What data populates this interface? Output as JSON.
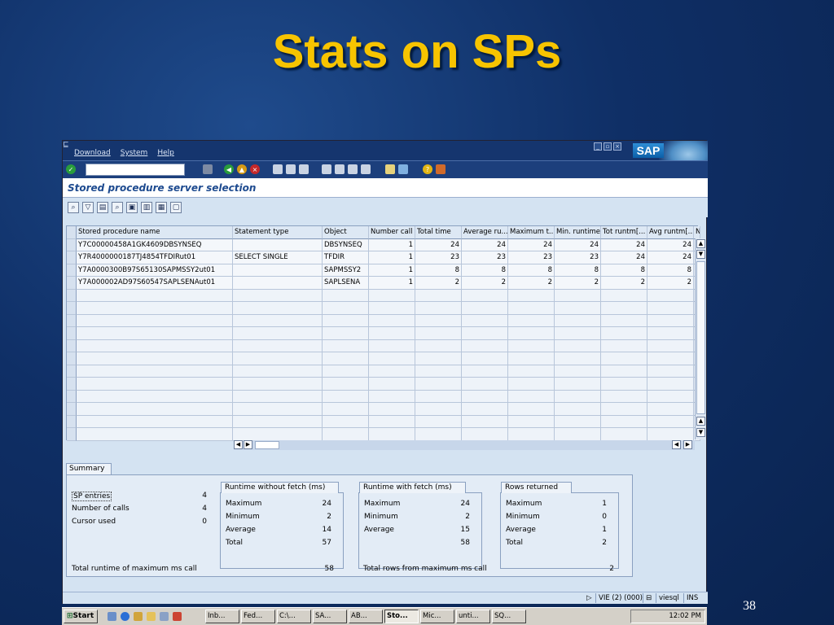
{
  "slide": {
    "title": "Stats on SPs",
    "number": "38"
  },
  "menu": {
    "items": [
      "Download",
      "System",
      "Help"
    ],
    "logo": "SAP"
  },
  "screen_title": "Stored procedure server selection",
  "grid": {
    "columns": [
      "Stored procedure name",
      "Statement type",
      "Object",
      "Number call",
      "Total time",
      "Average ru...",
      "Maximum t...",
      "Min. runtime",
      "Tot runtm[...",
      "Avg runtm[...",
      "N"
    ],
    "rows": [
      [
        "Y7C00000458A1GK4609DBSYNSEQ",
        "",
        "DBSYNSEQ",
        "1",
        "24",
        "24",
        "24",
        "24",
        "24",
        "24"
      ],
      [
        "Y7R4000000187TJ4854TFDIRut01",
        "SELECT SINGLE",
        "TFDIR",
        "1",
        "23",
        "23",
        "23",
        "23",
        "24",
        "24"
      ],
      [
        "Y7A0000300B97S65130SAPMSSY2ut01",
        "",
        "SAPMSSY2",
        "1",
        "8",
        "8",
        "8",
        "8",
        "8",
        "8"
      ],
      [
        "Y7A000002AD97S60547SAPLSENAut01",
        "",
        "SAPLSENA",
        "1",
        "2",
        "2",
        "2",
        "2",
        "2",
        "2"
      ]
    ]
  },
  "summary": {
    "tab": "Summary",
    "left": [
      {
        "label": "SP entries",
        "value": "4"
      },
      {
        "label": "Number of calls",
        "value": "4"
      },
      {
        "label": "Cursor used",
        "value": "0"
      }
    ],
    "runtime_without_fetch": {
      "title": "Runtime without fetch (ms)",
      "rows": [
        {
          "label": "Maximum",
          "value": "24"
        },
        {
          "label": "Minimum",
          "value": "2"
        },
        {
          "label": "Average",
          "value": "14"
        },
        {
          "label": "Total",
          "value": "57"
        }
      ]
    },
    "runtime_with_fetch": {
      "title": "Runtime with fetch (ms)",
      "rows": [
        {
          "label": "Maximum",
          "value": "24"
        },
        {
          "label": "Minimum",
          "value": "2"
        },
        {
          "label": "Average",
          "value": "15"
        },
        {
          "label": "",
          "value": "58"
        }
      ]
    },
    "rows_returned": {
      "title": "Rows returned",
      "rows": [
        {
          "label": "Maximum",
          "value": "1"
        },
        {
          "label": "Minimum",
          "value": "0"
        },
        {
          "label": "Average",
          "value": "1"
        },
        {
          "label": "Total",
          "value": "2"
        }
      ]
    },
    "footer": {
      "total_runtime_label": "Total runtime of maximum ms call",
      "total_runtime_value": "58",
      "total_rows_label": "Total rows from maximum ms call",
      "total_rows_value": "2"
    }
  },
  "status": {
    "system": "VIE (2) (000)",
    "server": "viesql",
    "mode": "INS"
  },
  "taskbar": {
    "start": "Start",
    "tasks": [
      "Inb...",
      "Fed...",
      "C:\\...",
      "SA...",
      "AB...",
      "Sto...",
      "Mic...",
      "unti...",
      "SQ..."
    ],
    "clock": "12:02 PM"
  },
  "colors": {
    "title": "#f7c400",
    "sap_bar": "#15356e",
    "accent": "#1d4a8f"
  }
}
